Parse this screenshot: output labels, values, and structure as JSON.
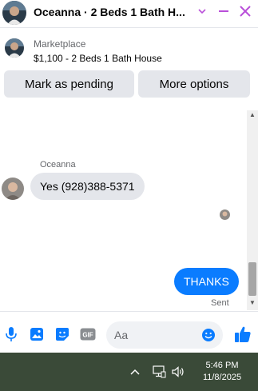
{
  "header": {
    "title": "Oceanna · 2 Beds 1 Bath H...",
    "icons": [
      "chevron-down-icon",
      "minimize-icon",
      "close-icon"
    ],
    "accent_color": "#b94fd9"
  },
  "marketplace": {
    "label": "Marketplace",
    "listing": "$1,100 - 2 Beds 1 Bath House",
    "buttons": {
      "pending": "Mark as pending",
      "more": "More options"
    }
  },
  "messages": {
    "received": {
      "sender": "Oceanna",
      "text": "Yes (928)388-5371"
    },
    "sent": {
      "text": "THANKS",
      "status": "Sent"
    }
  },
  "composer": {
    "placeholder": "Aa",
    "icons": [
      "microphone-icon",
      "image-icon",
      "sticker-icon",
      "gif-icon",
      "emoji-icon",
      "thumbs-up-icon"
    ],
    "gif_label": "GIF",
    "accent_color": "#0a7cff"
  },
  "taskbar": {
    "time": "5:46 PM",
    "date": "11/8/2025",
    "icons": [
      "chevron-up-icon",
      "network-icon",
      "volume-icon"
    ]
  }
}
